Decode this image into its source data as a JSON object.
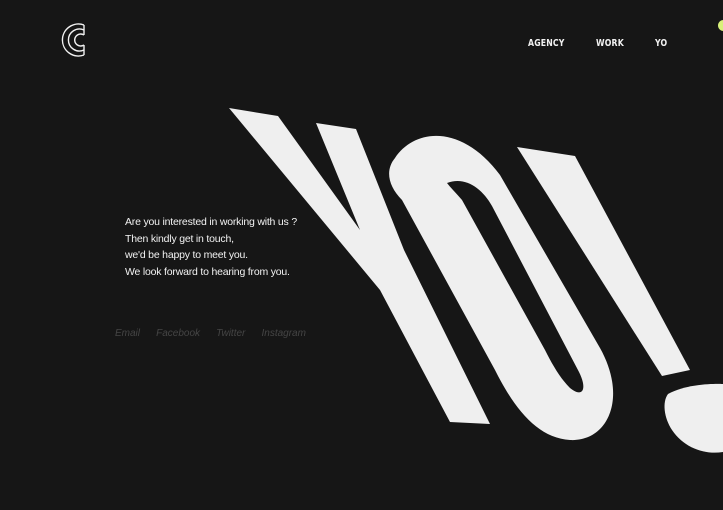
{
  "logo": {
    "icon": "c-logo-icon"
  },
  "nav": {
    "items": [
      {
        "label": "AGENCY"
      },
      {
        "label": "WORK"
      },
      {
        "label": "YO"
      }
    ],
    "accent_color": "#d8f07a"
  },
  "hero": {
    "headline": "YO!",
    "text_color": "#efefef",
    "background": "#161616"
  },
  "message": {
    "lines": [
      "Are you interested in working with us ?",
      "Then kindly get in touch,",
      "we'd be happy to meet you.",
      "We look forward to hearing from you."
    ]
  },
  "social": {
    "links": [
      {
        "label": "Email"
      },
      {
        "label": "Facebook"
      },
      {
        "label": "Twitter"
      },
      {
        "label": "Instagram"
      }
    ]
  }
}
